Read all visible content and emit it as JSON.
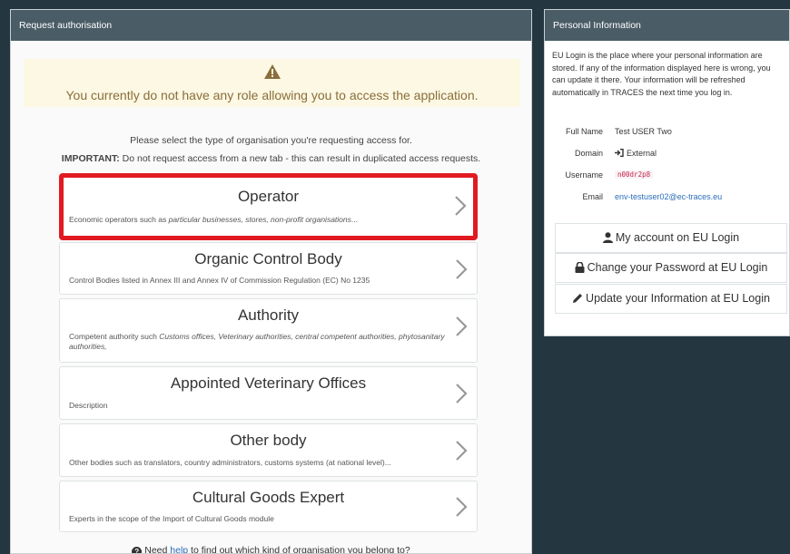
{
  "left_panel": {
    "title": "Request authorisation",
    "warning": {
      "icon": "warning-triangle-icon",
      "text": "You currently do not have any role allowing you to access the application."
    },
    "select_text": "Please select the type of organisation you're requesting access for.",
    "important_label": "IMPORTANT:",
    "important_text": " Do not request access from a new tab - this can result in duplicated access requests.",
    "organisations": [
      {
        "title": "Operator",
        "desc_prefix": "Economic operators such as ",
        "desc_italic": "particular businesses, stores, non-profit organisations",
        "desc_suffix": "...",
        "highlighted": true
      },
      {
        "title": "Organic Control Body",
        "desc_prefix": "Control Bodies listed in Annex III and Annex IV of Commission Regulation (EC) No 1235",
        "desc_italic": "",
        "desc_suffix": ""
      },
      {
        "title": "Authority",
        "desc_prefix": "Competent authority such ",
        "desc_italic": "Customs offices, Veterinary authorities, central competent authorities, phytosanitary authorities,",
        "desc_suffix": ""
      },
      {
        "title": "Appointed Veterinary Offices",
        "desc_prefix": "Description",
        "desc_italic": "",
        "desc_suffix": ""
      },
      {
        "title": "Other body",
        "desc_prefix": "Other bodies such as translators, country administrators, customs systems (at national level)...",
        "desc_italic": "",
        "desc_suffix": ""
      },
      {
        "title": "Cultural Goods Expert",
        "desc_prefix": "Experts in the scope of the Import of Cultural Goods module",
        "desc_italic": "",
        "desc_suffix": ""
      }
    ],
    "help": {
      "prefix": "Need ",
      "link": "help",
      "suffix": " to find out which kind of organisation you belong to?"
    }
  },
  "right_panel": {
    "title": "Personal Information",
    "info_text": "EU Login is the place where your personal information are stored. If any of the information displayed here is wrong, you can update it there. Your information will be refreshed automatically in TRACES the next time you log in.",
    "fields": {
      "full_name_label": "Full Name",
      "full_name_value": "Test USER Two",
      "domain_label": "Domain",
      "domain_value": "External",
      "username_label": "Username",
      "username_value": "n00dr2p8",
      "email_label": "Email",
      "email_value": "env-testuser02@ec-traces.eu"
    },
    "buttons": {
      "my_account": "My account on EU Login",
      "change_password": "Change your Password at EU Login",
      "update_info": "Update your Information at EU Login"
    }
  },
  "colors": {
    "background": "#243640",
    "header": "#4a5d67",
    "highlight_border": "#e11a22",
    "warning_bg": "#fcf8e3",
    "warning_text": "#8a6d3b",
    "link": "#2a6ebb"
  }
}
